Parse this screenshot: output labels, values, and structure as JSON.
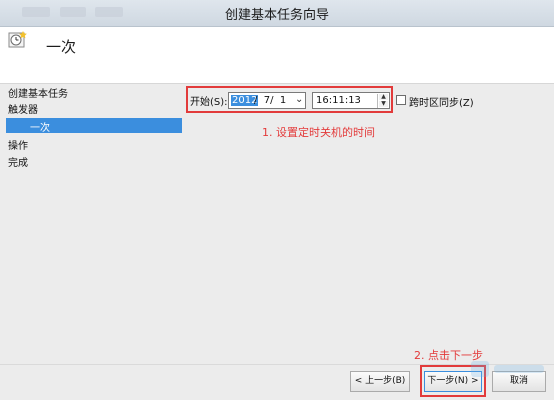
{
  "window": {
    "title": "创建基本任务向导"
  },
  "header": {
    "title": "一次"
  },
  "sidebar": {
    "items": [
      {
        "label": "创建基本任务"
      },
      {
        "label": "触发器"
      },
      {
        "label": "一次"
      },
      {
        "label": "操作"
      },
      {
        "label": "完成"
      }
    ]
  },
  "form": {
    "start_label": "开始(S):",
    "date_year": "2012",
    "date_rest": "/  7/  1",
    "time_value": "16:11:13",
    "timezone_sync_label": "跨时区同步(Z)",
    "timezone_sync_checked": false
  },
  "annotations": {
    "step1": "1. 设置定时关机的时间",
    "step2": "2. 点击下一步"
  },
  "footer": {
    "back_label": "< 上一步(B)",
    "next_label": "下一步(N) >",
    "cancel_label": "取消"
  },
  "colors": {
    "accent": "#3b8ede",
    "annotation": "#e33a3a"
  }
}
